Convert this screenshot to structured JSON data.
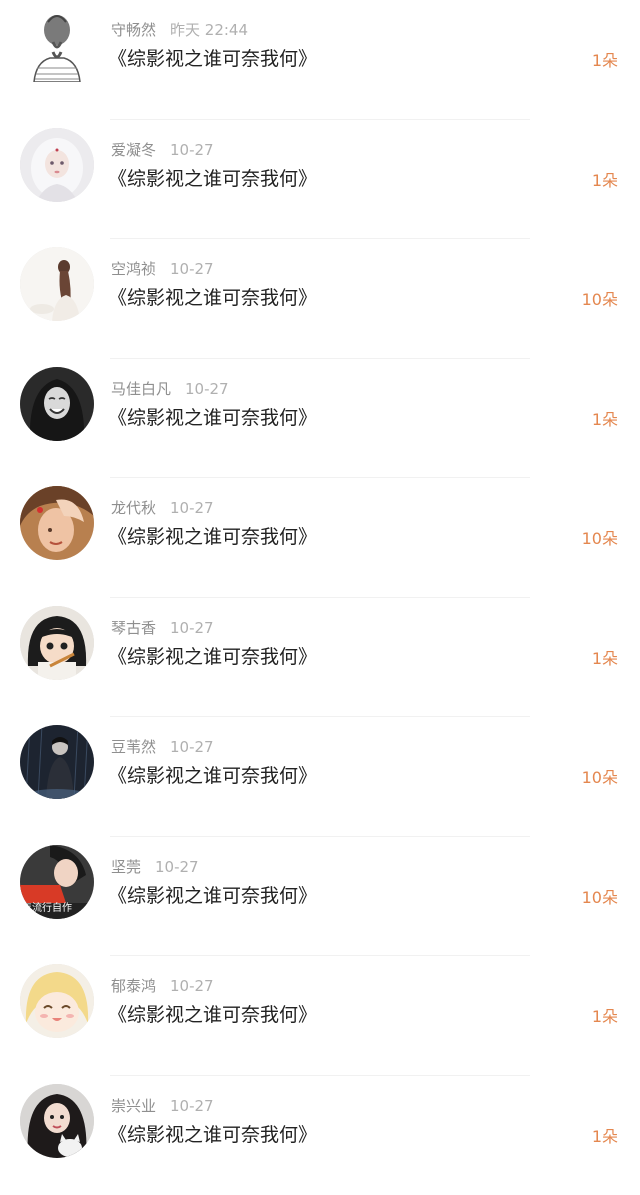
{
  "gift_list": [
    {
      "user": "守畅然",
      "time": "昨天 22:44",
      "title": "《综影视之谁可奈我何》",
      "amount": "1朵",
      "avatar": "avatar-sketch-braid-girl-icon"
    },
    {
      "user": "爱凝冬",
      "time": "10-27",
      "title": "《综影视之谁可奈我何》",
      "amount": "1朵",
      "avatar": "avatar-white-hair-girl-icon"
    },
    {
      "user": "空鸿祯",
      "time": "10-27",
      "title": "《综影视之谁可奈我何》",
      "amount": "10朵",
      "avatar": "avatar-long-hair-girl-icon"
    },
    {
      "user": "马佳白凡",
      "time": "10-27",
      "title": "《综影视之谁可奈我何》",
      "amount": "1朵",
      "avatar": "avatar-bw-smiling-woman-icon"
    },
    {
      "user": "龙代秋",
      "time": "10-27",
      "title": "《综影视之谁可奈我何》",
      "amount": "10朵",
      "avatar": "avatar-hand-on-head-girl-icon"
    },
    {
      "user": "琴古香",
      "time": "10-27",
      "title": "《综影视之谁可奈我何》",
      "amount": "1朵",
      "avatar": "avatar-child-girl-icon"
    },
    {
      "user": "豆苇然",
      "time": "10-27",
      "title": "《综影视之谁可奈我何》",
      "amount": "10朵",
      "avatar": "avatar-rainy-person-icon"
    },
    {
      "user": "坚莞",
      "time": "10-27",
      "title": "《综影视之谁可奈我何》",
      "amount": "10朵",
      "avatar": "avatar-girl-red-shirt-icon"
    },
    {
      "user": "郁泰鸿",
      "time": "10-27",
      "title": "《综影视之谁可奈我何》",
      "amount": "1朵",
      "avatar": "avatar-anime-blonde-girl-icon"
    },
    {
      "user": "崇兴业",
      "time": "10-27",
      "title": "《综影视之谁可奈我何》",
      "amount": "1朵",
      "avatar": "avatar-girl-with-cat-icon"
    }
  ],
  "avatar_caption": "年流行自作"
}
